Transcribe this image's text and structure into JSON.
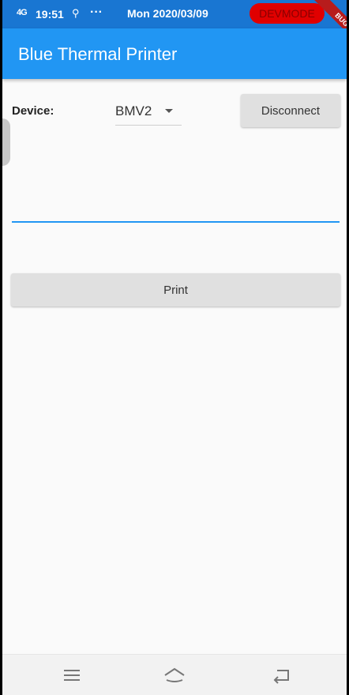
{
  "status_bar": {
    "signal_text": "4G",
    "time": "19:51",
    "usb_icon": "usb-icon",
    "more": "···",
    "date": "Mon 2020/03/09",
    "devmode_label": "DEVMODE",
    "debug_banner": "BUG"
  },
  "app_bar": {
    "title": "Blue Thermal Printer"
  },
  "device_row": {
    "label": "Device:",
    "selected_device": "BMV2",
    "disconnect_label": "Disconnect"
  },
  "text_field": {
    "value": "",
    "placeholder": ""
  },
  "print_button": {
    "label": "Print"
  },
  "nav_bar": {
    "icons": [
      "menu-icon",
      "home-icon",
      "back-icon"
    ]
  },
  "colors": {
    "status_bar": "#1976d2",
    "app_bar": "#2196f3",
    "accent": "#2196f3",
    "devmode": "#e00000",
    "button": "#e0e0e0"
  }
}
